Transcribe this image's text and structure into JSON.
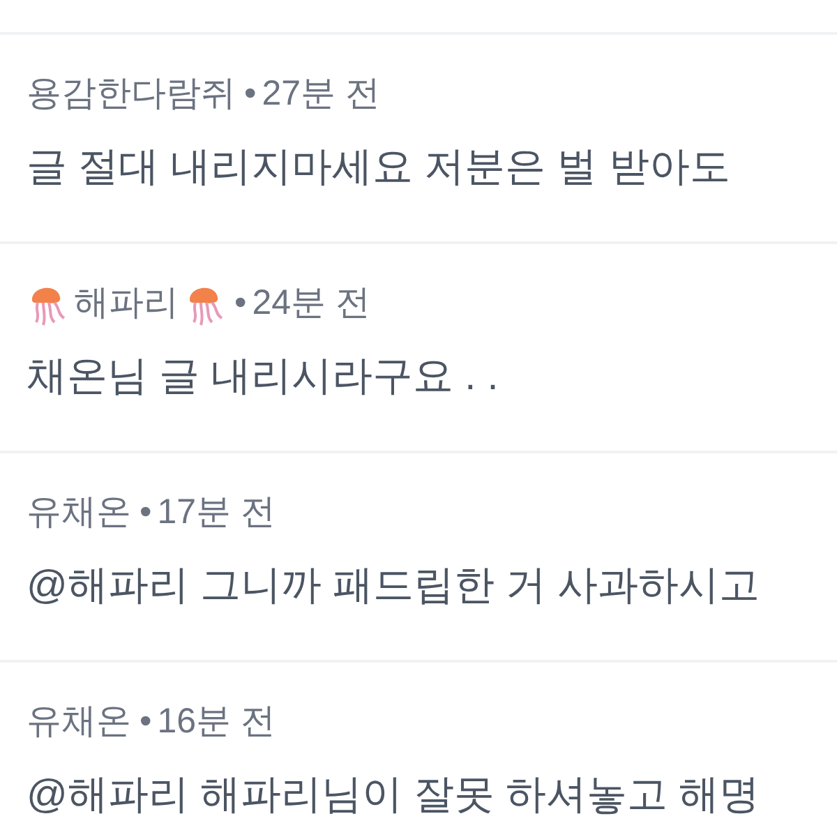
{
  "comments": [
    {
      "author": "용감한다람쥐",
      "jellyfish": false,
      "separator": "•",
      "time": "27분 전",
      "text": "글 절대 내리지마세요 저분은 벌 받아도"
    },
    {
      "author": "해파리",
      "jellyfish": true,
      "separator": "•",
      "time": "24분 전",
      "text": "채온님 글 내리시라구요 . ."
    },
    {
      "author": "유채온",
      "jellyfish": false,
      "separator": "•",
      "time": "17분 전",
      "text": "@해파리 그니까 패드립한 거 사과하시고"
    },
    {
      "author": "유채온",
      "jellyfish": false,
      "separator": "•",
      "time": "16분 전",
      "text": "@해파리 해파리님이 잘못 하셔놓고 해명"
    }
  ]
}
